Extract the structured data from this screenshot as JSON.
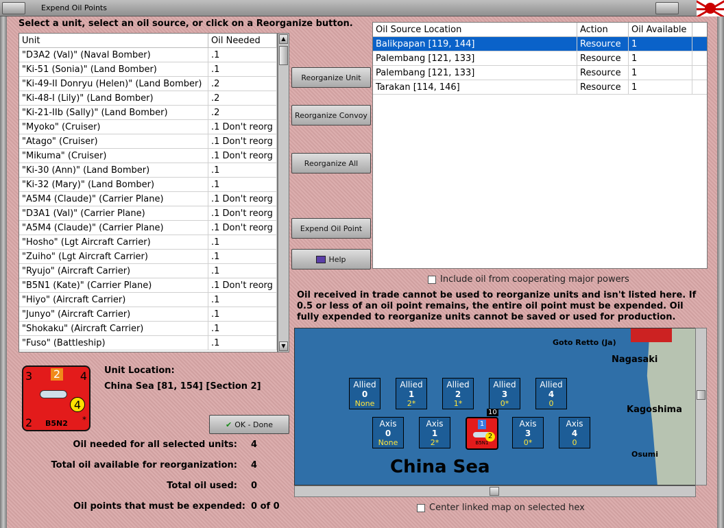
{
  "window": {
    "title": "Expend Oil Points"
  },
  "instruction": "Select a unit, select an oil source, or click on a Reorganize button.",
  "units_table": {
    "columns": [
      "Unit",
      "Oil Needed"
    ],
    "rows": [
      [
        "\"D3A2 (Val)\" (Naval Bomber)",
        ".1"
      ],
      [
        "\"Ki-51 (Sonia)\" (Land Bomber)",
        ".1"
      ],
      [
        "\"Ki-49-II Donryu (Helen)\" (Land Bomber)",
        ".2"
      ],
      [
        "\"Ki-48-I (Lily)\" (Land Bomber)",
        ".2"
      ],
      [
        "\"Ki-21-IIb (Sally)\" (Land Bomber)",
        ".2"
      ],
      [
        "\"Myoko\" (Cruiser)",
        ".1 Don't reorg"
      ],
      [
        "\"Atago\" (Cruiser)",
        ".1 Don't reorg"
      ],
      [
        "\"Mikuma\" (Cruiser)",
        ".1 Don't reorg"
      ],
      [
        "\"Ki-30 (Ann)\" (Land Bomber)",
        ".1"
      ],
      [
        "\"Ki-32 (Mary)\" (Land Bomber)",
        ".1"
      ],
      [
        "\"A5M4 (Claude)\" (Carrier Plane)",
        ".1 Don't reorg"
      ],
      [
        "\"D3A1 (Val)\" (Carrier Plane)",
        ".1 Don't reorg"
      ],
      [
        "\"A5M4 (Claude)\" (Carrier Plane)",
        ".1 Don't reorg"
      ],
      [
        "\"Hosho\" (Lgt Aircraft Carrier)",
        ".1"
      ],
      [
        "\"Zuiho\" (Lgt Aircraft Carrier)",
        ".1"
      ],
      [
        "\"Ryujo\" (Aircraft Carrier)",
        ".1"
      ],
      [
        "\"B5N1 (Kate)\" (Carrier Plane)",
        ".1 Don't reorg"
      ],
      [
        "\"Hiyo\" (Aircraft Carrier)",
        ".1"
      ],
      [
        "\"Junyo\" (Aircraft Carrier)",
        ".1"
      ],
      [
        "\"Shokaku\" (Aircraft Carrier)",
        ".1"
      ],
      [
        "\"Fuso\" (Battleship)",
        ".1"
      ]
    ]
  },
  "buttons": {
    "reorganize_unit": "Reorganize Unit",
    "reorganize_convoy": "Reorganize Convoy",
    "reorganize_all": "Reorganize All",
    "expend_oil_point": "Expend Oil Point",
    "help": "Help",
    "ok_done": "OK - Done"
  },
  "oil_table": {
    "columns": [
      "Oil Source Location",
      "Action",
      "Oil Available"
    ],
    "rows": [
      [
        "Balikpapan [119, 144]",
        "Resource",
        "1"
      ],
      [
        "Palembang [121, 133]",
        "Resource",
        "1"
      ],
      [
        "Palembang [121, 133]",
        "Resource",
        "1"
      ],
      [
        "Tarakan [114, 146]",
        "Resource",
        "1"
      ]
    ],
    "selected_index": 0
  },
  "include_cooperating": "Include oil from cooperating major powers",
  "note": "Oil received in trade cannot be used to reorganize units and isn't listed here.  If 0.5 or less of an oil point remains, the entire oil point must be expended.   Oil fully expended to reorganize units cannot be saved or used for production.",
  "counter": {
    "tl": "3",
    "tm": "2",
    "tr": "4",
    "circle": "4",
    "bl": "2",
    "name": "B5N2",
    "star": "*"
  },
  "unit_location": {
    "label": "Unit Location:",
    "value": "China Sea [81, 154] [Section 2]"
  },
  "totals": [
    {
      "label": "Oil needed for all selected units:",
      "value": "4"
    },
    {
      "label": "Total oil available for reorganization:",
      "value": "4"
    },
    {
      "label": "Total oil used:",
      "value": "0"
    },
    {
      "label": "Oil points that must be expended:",
      "value": "0 of 0"
    }
  ],
  "map": {
    "sea_label": "China Sea",
    "places": {
      "goto": "Goto Retto (Ja)",
      "nagasaki": "Nagasaki",
      "kagoshima": "Kagoshima",
      "osumi": "Osumi"
    },
    "allied": [
      {
        "label": "Allied",
        "num": "0",
        "val": "None"
      },
      {
        "label": "Allied",
        "num": "1",
        "val": "2*"
      },
      {
        "label": "Allied",
        "num": "2",
        "val": "1*"
      },
      {
        "label": "Allied",
        "num": "3",
        "val": "0*"
      },
      {
        "label": "Allied",
        "num": "4",
        "val": "0"
      }
    ],
    "axis": [
      {
        "label": "Axis",
        "num": "0",
        "val": "None"
      },
      {
        "label": "Axis",
        "num": "1",
        "val": "2*"
      },
      {
        "label": "Axis",
        "num": "3",
        "val": "0*"
      },
      {
        "label": "Axis",
        "num": "4",
        "val": "0"
      }
    ],
    "mini_counter": {
      "top": "1",
      "stack": "10",
      "circle": "2",
      "name": "B5N1"
    }
  },
  "center_linked": "Center linked map on selected hex"
}
